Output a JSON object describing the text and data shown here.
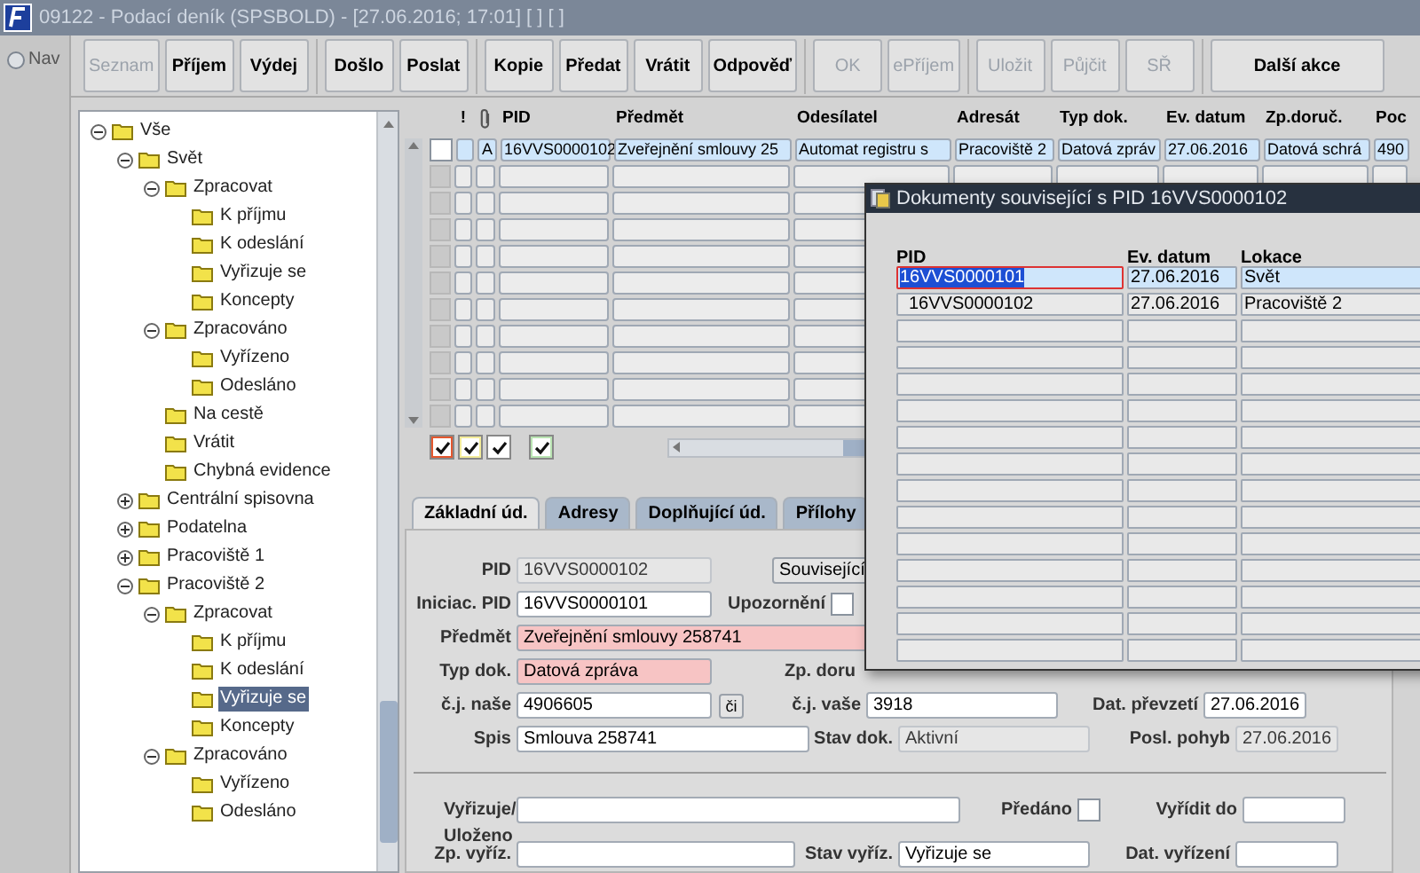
{
  "window": {
    "title": "09122 - Podací deník (SPSBOLD) - [27.06.2016; 17:01] [ ] [ ]"
  },
  "nav": {
    "label": "Nav",
    "selected": false
  },
  "toolbar": [
    [
      {
        "label": "Seznam",
        "disabled": true
      },
      {
        "label": "Příjem",
        "disabled": false
      },
      {
        "label": "Výdej",
        "disabled": false
      }
    ],
    [
      {
        "label": "Došlo",
        "disabled": false
      },
      {
        "label": "Poslat",
        "disabled": false
      }
    ],
    [
      {
        "label": "Kopie",
        "disabled": false
      },
      {
        "label": "Předat",
        "disabled": false
      },
      {
        "label": "Vrátit",
        "disabled": false
      },
      {
        "label": "Odpověď",
        "disabled": false
      }
    ],
    [
      {
        "label": "OK",
        "disabled": true
      },
      {
        "label": "ePříjem",
        "disabled": true
      }
    ],
    [
      {
        "label": "Uložit",
        "disabled": true
      },
      {
        "label": "Půjčit",
        "disabled": true
      },
      {
        "label": "SŘ",
        "disabled": true
      }
    ],
    [
      {
        "label": "Další akce",
        "disabled": false
      }
    ]
  ],
  "tree": [
    {
      "label": "Vše",
      "selected": false,
      "expanded": true,
      "children": [
        {
          "label": "Svět",
          "selected": false,
          "expanded": true,
          "children": [
            {
              "label": "Zpracovat",
              "selected": false,
              "expanded": true,
              "children": [
                {
                  "label": "K příjmu",
                  "selected": false
                },
                {
                  "label": "K odeslání",
                  "selected": false
                },
                {
                  "label": "Vyřizuje se",
                  "selected": false
                },
                {
                  "label": "Koncepty",
                  "selected": false
                }
              ]
            },
            {
              "label": "Zpracováno",
              "selected": false,
              "expanded": true,
              "children": [
                {
                  "label": "Vyřízeno",
                  "selected": false
                },
                {
                  "label": "Odesláno",
                  "selected": false
                }
              ]
            },
            {
              "label": "Na cestě",
              "selected": false
            },
            {
              "label": "Vrátit",
              "selected": false
            },
            {
              "label": "Chybná evidence",
              "selected": false
            }
          ]
        },
        {
          "label": "Centrální spisovna",
          "selected": false,
          "expanded": false
        },
        {
          "label": "Podatelna",
          "selected": false,
          "expanded": false
        },
        {
          "label": "Pracoviště 1",
          "selected": false,
          "expanded": false
        },
        {
          "label": "Pracoviště 2",
          "selected": false,
          "expanded": true,
          "children": [
            {
              "label": "Zpracovat",
              "selected": false,
              "expanded": true,
              "children": [
                {
                  "label": "K příjmu",
                  "selected": false
                },
                {
                  "label": "K odeslání",
                  "selected": false
                },
                {
                  "label": "Vyřizuje se",
                  "selected": true
                },
                {
                  "label": "Koncepty",
                  "selected": false
                }
              ]
            },
            {
              "label": "Zpracováno",
              "selected": false,
              "expanded": true,
              "children": [
                {
                  "label": "Vyřízeno",
                  "selected": false
                },
                {
                  "label": "Odesláno",
                  "selected": false
                }
              ]
            }
          ]
        }
      ]
    }
  ],
  "grid": {
    "columns": [
      {
        "kind": "text",
        "label": "!"
      },
      {
        "kind": "attachment"
      },
      {
        "kind": "text",
        "label": "PID"
      },
      {
        "kind": "text",
        "label": "Předmět"
      },
      {
        "kind": "text",
        "label": "Odesílatel"
      },
      {
        "kind": "text",
        "label": "Adresát"
      },
      {
        "kind": "text",
        "label": "Typ dok."
      },
      {
        "kind": "text",
        "label": "Ev. datum"
      },
      {
        "kind": "text",
        "label": "Zp.doruč."
      },
      {
        "kind": "text",
        "label": "Poc"
      }
    ],
    "rows": [
      {
        "selected": true,
        "checked": false,
        "cells": [
          "",
          "A",
          "16VVS0000102",
          "Zveřejnění smlouvy 25",
          "Automat registru s",
          "Pracoviště 2",
          "Datová zpráv",
          "27.06.2016",
          "Datová schrá",
          "490"
        ]
      }
    ]
  },
  "filters": [
    [
      {
        "color": "#e4572e",
        "checked": true
      },
      {
        "color": "#f3ec9a",
        "checked": true
      },
      {
        "color": "#ffffff",
        "checked": true
      }
    ],
    [
      {
        "color": "#b9e4b2",
        "checked": true
      }
    ]
  ],
  "tabs": [
    {
      "label": "Základní úd.",
      "selected": true
    },
    {
      "label": "Adresy",
      "selected": false
    },
    {
      "label": "Doplňující úd.",
      "selected": false
    },
    {
      "label": "Přílohy",
      "selected": false
    }
  ],
  "form": {
    "pid": {
      "label": "PID",
      "value": "16VVS0000102",
      "readonly": true,
      "required": false
    },
    "related_button": "Související",
    "initiating_pid": {
      "label": "Iniciac. PID",
      "value": "16VVS0000101",
      "readonly": false,
      "required": false
    },
    "notice": {
      "label": "Upozornění",
      "checked": false
    },
    "subject": {
      "label": "Předmět",
      "value": "Zveřejnění smlouvy 258741",
      "readonly": false,
      "required": true
    },
    "doc_type": {
      "label": "Typ dok.",
      "value": "Datová zpráva",
      "readonly": false,
      "required": true
    },
    "delivery_label": "Zp. doru",
    "ref_ours": {
      "label": "č.j. naše",
      "value": "4906605",
      "readonly": false,
      "required": false
    },
    "ref_button": "či",
    "ref_yours": {
      "label": "č.j. vaše",
      "value": "3918",
      "readonly": false,
      "required": false
    },
    "received": {
      "label": "Dat. převzetí",
      "value": "27.06.2016",
      "readonly": false,
      "required": false
    },
    "file": {
      "label": "Spis",
      "value": "Smlouva 258741",
      "readonly": false,
      "required": false
    },
    "doc_state": {
      "label": "Stav dok.",
      "value": "Aktivní",
      "readonly": true,
      "required": false
    },
    "last_move": {
      "label": "Posl. pohyb",
      "value": "27.06.2016",
      "readonly": true,
      "required": false
    },
    "handler": {
      "label": "Vyřizuje/ Uloženo",
      "readonly": false,
      "required": false
    },
    "handed": {
      "label": "Předáno",
      "checked": false
    },
    "due": {
      "label": "Vyřídit do",
      "readonly": false,
      "required": false
    },
    "settle_mode": {
      "label": "Zp. vyříz.",
      "readonly": false,
      "required": false
    },
    "settle_state": {
      "label": "Stav vyříz.",
      "value": "Vyřizuje se",
      "readonly": false,
      "required": false
    },
    "settled": {
      "label": "Dat. vyřízení",
      "readonly": false,
      "required": false
    }
  },
  "popup": {
    "title": "Dokumenty související s PID 16VVS0000102",
    "columns": [
      "PID",
      "Ev. datum",
      "Lokace"
    ],
    "rows": [
      {
        "selected": true,
        "focused": true,
        "cells": [
          "16VVS0000101",
          "27.06.2016",
          "Svět"
        ]
      },
      {
        "selected": false,
        "focused": false,
        "cells": [
          "16VVS0000102",
          "27.06.2016",
          "Pracoviště 2"
        ]
      }
    ]
  }
}
